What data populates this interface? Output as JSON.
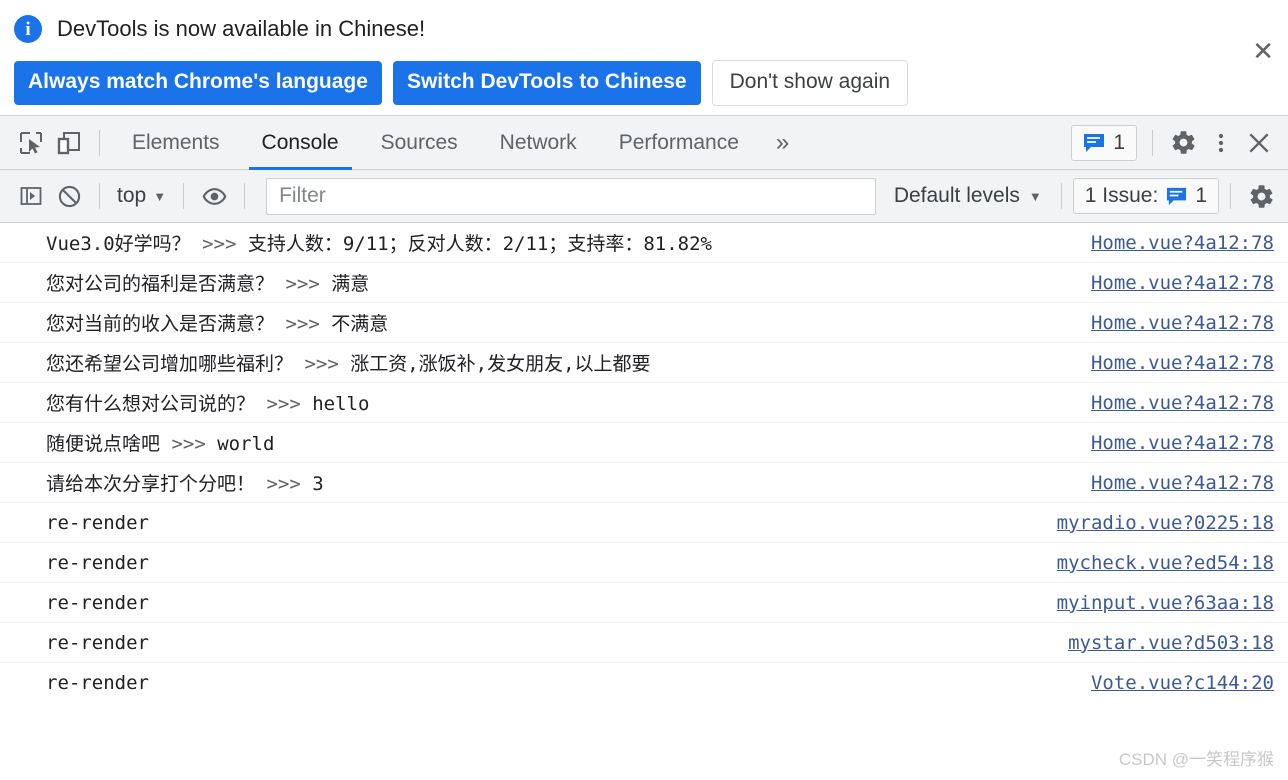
{
  "banner": {
    "message": "DevTools is now available in Chinese!",
    "info_icon": "info-icon",
    "primary_button": "Always match Chrome's language",
    "secondary_button": "Switch DevTools to Chinese",
    "dismiss_button": "Don't show again",
    "close_icon": "✕",
    "accent_color": "#1a73e8"
  },
  "tabbar": {
    "inspect_icon": "inspect-element-icon",
    "device_icon": "device-toolbar-icon",
    "tabs": [
      {
        "label": "Elements",
        "active": false
      },
      {
        "label": "Console",
        "active": true
      },
      {
        "label": "Sources",
        "active": false
      },
      {
        "label": "Network",
        "active": false
      },
      {
        "label": "Performance",
        "active": false
      }
    ],
    "more_tabs_icon": "»",
    "issue_count": "1",
    "settings_icon": "gear-icon",
    "more_options_icon": "kebab-menu-icon",
    "close_icon": "✕"
  },
  "filterbar": {
    "sidebar_icon": "console-sidebar-icon",
    "clear_icon": "clear-console-icon",
    "context": "top",
    "eye_icon": "live-expression-icon",
    "filter_placeholder": "Filter",
    "filter_value": "",
    "levels": "Default levels",
    "issues_label": "1 Issue:",
    "issues_count": "1",
    "settings_icon": "console-settings-icon"
  },
  "console": {
    "messages": [
      {
        "text": "Vue3.0好学吗？ ",
        "arrows": ">>>",
        "detail": " 支持人数：9/11；反对人数：2/11；支持率：81.82%",
        "source": "Home.vue?4a12:78"
      },
      {
        "text": "您对公司的福利是否满意？ ",
        "arrows": ">>>",
        "detail": " 满意",
        "source": "Home.vue?4a12:78"
      },
      {
        "text": "您对当前的收入是否满意？ ",
        "arrows": ">>>",
        "detail": " 不满意",
        "source": "Home.vue?4a12:78"
      },
      {
        "text": "您还希望公司增加哪些福利？ ",
        "arrows": ">>>",
        "detail": " 涨工资,涨饭补,发女朋友,以上都要",
        "source": "Home.vue?4a12:78"
      },
      {
        "text": "您有什么想对公司说的？ ",
        "arrows": ">>>",
        "detail": " hello",
        "source": "Home.vue?4a12:78"
      },
      {
        "text": "随便说点啥吧 ",
        "arrows": ">>>",
        "detail": " world",
        "source": "Home.vue?4a12:78"
      },
      {
        "text": "请给本次分享打个分吧！ ",
        "arrows": ">>>",
        "detail": " 3",
        "source": "Home.vue?4a12:78"
      },
      {
        "text": "re-render",
        "arrows": "",
        "detail": "",
        "source": "myradio.vue?0225:18"
      },
      {
        "text": "re-render",
        "arrows": "",
        "detail": "",
        "source": "mycheck.vue?ed54:18"
      },
      {
        "text": "re-render",
        "arrows": "",
        "detail": "",
        "source": "myinput.vue?63aa:18"
      },
      {
        "text": "re-render",
        "arrows": "",
        "detail": "",
        "source": "mystar.vue?d503:18"
      },
      {
        "text": "re-render",
        "arrows": "",
        "detail": "",
        "source": "Vote.vue?c144:20"
      }
    ],
    "prompt_caret": "❯"
  },
  "watermark": "CSDN @一笑程序猴"
}
